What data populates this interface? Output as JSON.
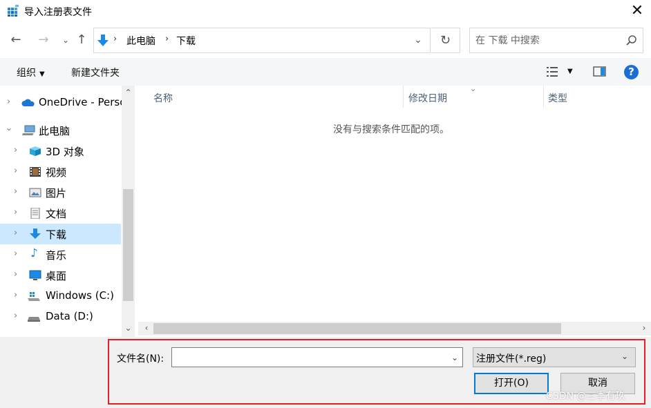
{
  "window": {
    "title": "导入注册表文件"
  },
  "navigation": {
    "breadcrumb": [
      "此电脑",
      "下载"
    ],
    "search_placeholder": "在 下载 中搜索"
  },
  "commands": {
    "organize": "组织",
    "new_folder": "新建文件夹"
  },
  "tree": {
    "items": [
      {
        "label": "OneDrive - Perso",
        "icon": "cloud-icon"
      },
      {
        "label": "此电脑",
        "icon": "computer-icon"
      },
      {
        "label": "3D 对象",
        "icon": "cube-icon"
      },
      {
        "label": "视频",
        "icon": "film-icon"
      },
      {
        "label": "图片",
        "icon": "picture-icon"
      },
      {
        "label": "文档",
        "icon": "document-icon"
      },
      {
        "label": "下载",
        "icon": "download-arrow-icon"
      },
      {
        "label": "音乐",
        "icon": "music-note-icon"
      },
      {
        "label": "桌面",
        "icon": "desktop-icon"
      },
      {
        "label": "Windows (C:)",
        "icon": "windows-drive-icon"
      },
      {
        "label": "Data (D:)",
        "icon": "drive-icon"
      }
    ],
    "selected": "下载"
  },
  "file_list": {
    "columns": [
      "名称",
      "修改日期",
      "类型"
    ],
    "empty_message": "没有与搜索条件匹配的项。"
  },
  "footer": {
    "filename_label": "文件名(N):",
    "filename_value": "",
    "filetype_value": "注册文件(*.reg)",
    "open_label": "打开(O)",
    "cancel_label": "取消"
  },
  "watermark": "CSDN @三季有玖",
  "colors": {
    "selection": "#cce8ff",
    "accent": "#0078d7",
    "highlight_box": "#e31f26"
  }
}
